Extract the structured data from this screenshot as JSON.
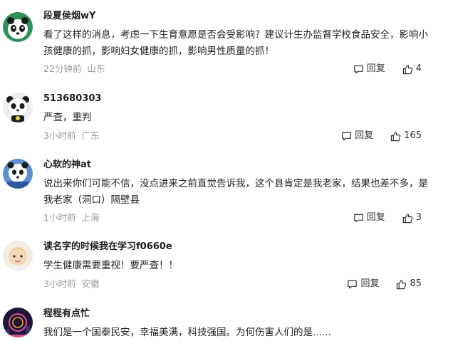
{
  "reply_label": "回复",
  "comments": [
    {
      "user": "段夏侯烟wY",
      "text": "看了这样的消息，考虑一下生育意愿是否会受影响？建议计生办监督学校食品安全，影响小孩健康的抓，影响妇女健康的抓，影响男性质量的抓！",
      "time": "22分钟前",
      "location": "山东",
      "likes": "4"
    },
    {
      "user": "513680303",
      "text": "严查，重判",
      "time": "3小时前",
      "location": "广东",
      "likes": "165"
    },
    {
      "user": "心软的神at",
      "text": "说出来你们可能不信，没点进来之前直觉告诉我，这个县肯定是我老家，结果也差不多，是我老家（洞口）隔壁县",
      "time": "1小时前",
      "location": "上海",
      "likes": "3"
    },
    {
      "user": "读名字的时候我在学习f0660e",
      "text": "学生健康需要重视！要严查！！",
      "time": "3小时前",
      "location": "安徽",
      "likes": "85"
    },
    {
      "user": "程程有点忙",
      "text": "我们是一个国泰民安，幸福美满，科技强国。为何伤害人们的是......",
      "time": "",
      "location": "",
      "likes": ""
    }
  ],
  "colors": {
    "text": "#222222",
    "meta": "#9a9a9a",
    "name": "#1f1f1f",
    "background": "#ffffff"
  }
}
